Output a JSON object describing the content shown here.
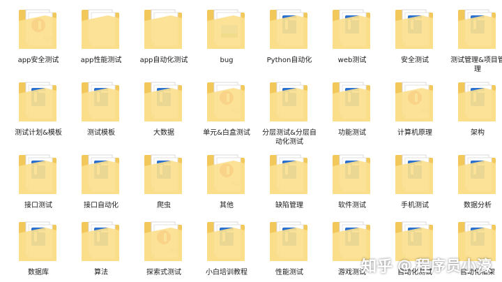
{
  "folders": [
    {
      "label": "app安全测试",
      "badge": "pdf-red"
    },
    {
      "label": "app性能测试",
      "badge": "blank"
    },
    {
      "label": "app自动化测试",
      "badge": "blank"
    },
    {
      "label": "bug",
      "badge": "image"
    },
    {
      "label": "Python自动化",
      "badge": "word-blue"
    },
    {
      "label": "web测试",
      "badge": "word-blue"
    },
    {
      "label": "安全测试",
      "badge": "word-blue"
    },
    {
      "label": "测试管理&项目管理",
      "badge": "word-blue"
    },
    {
      "label": "测试计划&模板",
      "badge": "word-blue"
    },
    {
      "label": "测试模板",
      "badge": "word-blue"
    },
    {
      "label": "大数据",
      "badge": "word-blue"
    },
    {
      "label": "单元&白盒测试",
      "badge": "pdf-red"
    },
    {
      "label": "分层测试&分层自动化测试",
      "badge": "word-blue"
    },
    {
      "label": "功能测试",
      "badge": "word-blue"
    },
    {
      "label": "计算机原理",
      "badge": "pdf-red"
    },
    {
      "label": "架构",
      "badge": "word-blue"
    },
    {
      "label": "接口测试",
      "badge": "word-blue"
    },
    {
      "label": "接口自动化",
      "badge": "word-blue"
    },
    {
      "label": "爬虫",
      "badge": "word-blue"
    },
    {
      "label": "其他",
      "badge": "pdf-red"
    },
    {
      "label": "缺陷管理",
      "badge": "word-blue"
    },
    {
      "label": "软件测试",
      "badge": "word-blue"
    },
    {
      "label": "手机测试",
      "badge": "word-blue"
    },
    {
      "label": "数据分析",
      "badge": "word-blue"
    },
    {
      "label": "数据库",
      "badge": "word-blue"
    },
    {
      "label": "算法",
      "badge": "word-blue"
    },
    {
      "label": "探索式测试",
      "badge": "pdf-red"
    },
    {
      "label": "小白培训教程",
      "badge": "word-blue"
    },
    {
      "label": "性能测试",
      "badge": "word-blue"
    },
    {
      "label": "游戏测试",
      "badge": "word-blue"
    },
    {
      "label": "自动化测试",
      "badge": "word-blue"
    },
    {
      "label": "自动化框架",
      "badge": "word-blue"
    }
  ],
  "watermark": {
    "zhihu": "知乎",
    "at": "@",
    "name": "程序员小濠"
  },
  "colors": {
    "folder_back": "#f3c85a",
    "folder_front": "#fbe08e",
    "paper": "#ffffff",
    "word_blue": "#2b6fd0",
    "pdf_red": "#e3473c",
    "label_text": "#1a1a1a"
  }
}
